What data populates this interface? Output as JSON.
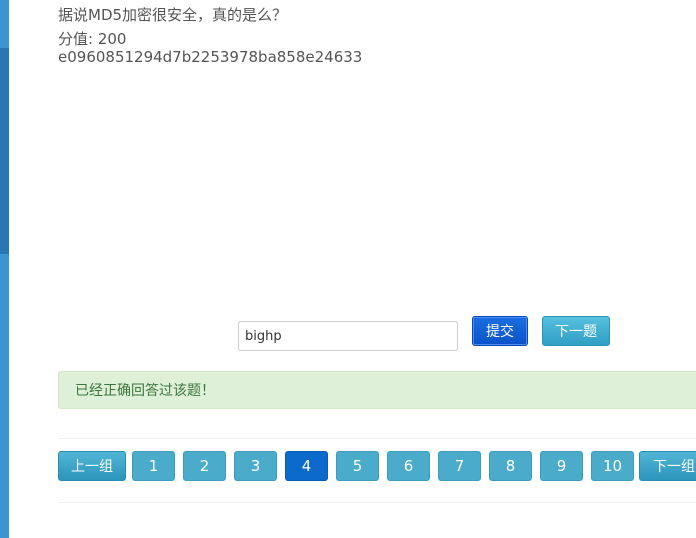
{
  "question": {
    "title": "据说MD5加密很安全，真的是么？",
    "score": "分值: 200",
    "hash": "e0960851294d7b2253978ba858e24633"
  },
  "answer": {
    "value": "bighp",
    "submit_label": "提交",
    "next_label": "下一题"
  },
  "alert": {
    "message": "已经正确回答过该题！"
  },
  "pagination": {
    "prev_group_label": "上一组",
    "next_group_label": "下一组",
    "pages": [
      "1",
      "2",
      "3",
      "4",
      "5",
      "6",
      "7",
      "8",
      "9",
      "10"
    ],
    "active_page": "4"
  },
  "colors": {
    "left_strip": "#3c94d4",
    "submit": "#0c52c9",
    "page_button": "#4aabca",
    "active_page": "#0c6acd",
    "alert_bg": "#dff0d8",
    "alert_text": "#3c763d"
  }
}
